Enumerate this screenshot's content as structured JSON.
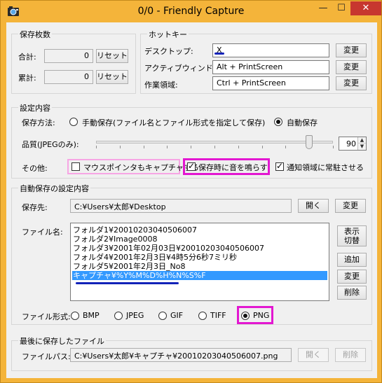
{
  "window": {
    "title": "0/0 - Friendly Capture",
    "minimize_glyph": "—",
    "maximize_glyph": "☐",
    "close_glyph": "✕",
    "colors": {
      "frame": "#f4b43a",
      "close_button": "#c7372f",
      "client": "#f0f0f0"
    }
  },
  "save_count": {
    "title": "保存枚数",
    "total_label": "合計:",
    "total_value": "0",
    "cumulative_label": "累計:",
    "cumulative_value": "0",
    "reset_label": "リセット"
  },
  "hotkeys": {
    "title": "ホットキー",
    "change_label": "変更",
    "rows": [
      {
        "label": "デスクトップ:",
        "value": "X"
      },
      {
        "label": "アクティブウィンドウ:",
        "value": "Alt + PrintScreen"
      },
      {
        "label": "作業領域:",
        "value": "Ctrl + PrintScreen"
      }
    ]
  },
  "settings": {
    "title": "設定内容",
    "save_method_label": "保存方法:",
    "manual_label": "手動保存(ファイル名とファイル形式を指定して保存)",
    "auto_label": "自動保存",
    "auto_selected": true,
    "quality_label": "品質(JPEGのみ):",
    "quality_value": "90",
    "quality_level": 90,
    "other_label": "その他:",
    "capture_mouse_label": "マウスポインタもキャプチャする",
    "capture_mouse_checked": false,
    "sound_label": "保存時に音を鳴らす",
    "sound_checked": true,
    "tray_label": "通知領域に常駐させる",
    "tray_checked": true
  },
  "auto_save": {
    "title": "自動保存の設定内容",
    "dest_label": "保存先:",
    "dest_value": "C:¥Users¥太郎¥Desktop",
    "open_label": "開く",
    "change_label": "変更",
    "filename_label": "ファイル名:",
    "filenames": [
      "フォルダ1¥20010203040506007",
      "フォルダ2¥Image0008",
      "フォルダ3¥2001年02月03日¥20010203040506007",
      "フォルダ4¥2001年2月3日¥4時5分6秒7ミリ秒",
      "フォルダ5¥2001年2月3日_No8",
      "キャプチャ¥%Y%M%D%H%N%S%F"
    ],
    "selected_index": 5,
    "toggle_label_line1": "表示",
    "toggle_label_line2": "切替",
    "add_label": "追加",
    "edit_label": "変更",
    "delete_label": "削除",
    "format_label": "ファイル形式:",
    "formats": [
      "BMP",
      "JPEG",
      "GIF",
      "TIFF",
      "PNG"
    ],
    "selected_format": "PNG"
  },
  "last_saved": {
    "title": "最後に保存したファイル",
    "path_label": "ファイルパス:",
    "path_value": "C:¥Users¥太郎¥キャプチャ¥20010203040506007.png",
    "open_label": "開く",
    "delete_label": "削除"
  },
  "annotation_colors": {
    "pink": "#f7a6e4",
    "magenta": "#e317d1",
    "blue_mark": "#1222b8"
  }
}
